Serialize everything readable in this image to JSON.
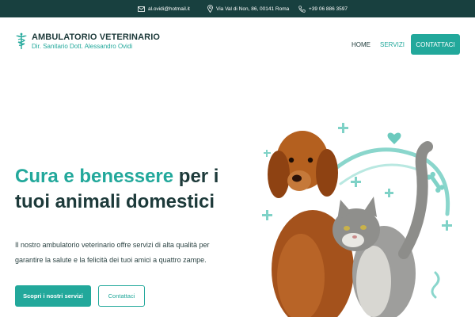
{
  "topbar": {
    "email": "al.ovidi@hotmail.it",
    "address": "Via Val di Non, 86, 00141 Roma",
    "phone": "+39 06 886 3597"
  },
  "brand": {
    "title": "AMBULATORIO VETERINARIO",
    "subtitle": "Dir. Sanitario Dott. Alessandro Ovidi"
  },
  "nav": {
    "home": "HOME",
    "servizi": "SERVIZI",
    "contattaci": "CONTATTACI"
  },
  "hero": {
    "title_part1": "Cura e benessere",
    "title_part2": " per i tuoi animali domestici",
    "text": "Il nostro ambulatorio veterinario offre servizi di alta qualità per garantire la salute e la felicità dei tuoi amici a quattro zampe.",
    "primary_button": "Scopri i nostri servizi",
    "secondary_button": "Contattaci"
  },
  "colors": {
    "brand_dark": "#18403f",
    "accent": "#22a89b",
    "text": "#1d3a3a"
  },
  "icons": {
    "email": "envelope-icon",
    "address": "map-pin-icon",
    "phone": "phone-icon",
    "logo": "caduceus-icon"
  }
}
